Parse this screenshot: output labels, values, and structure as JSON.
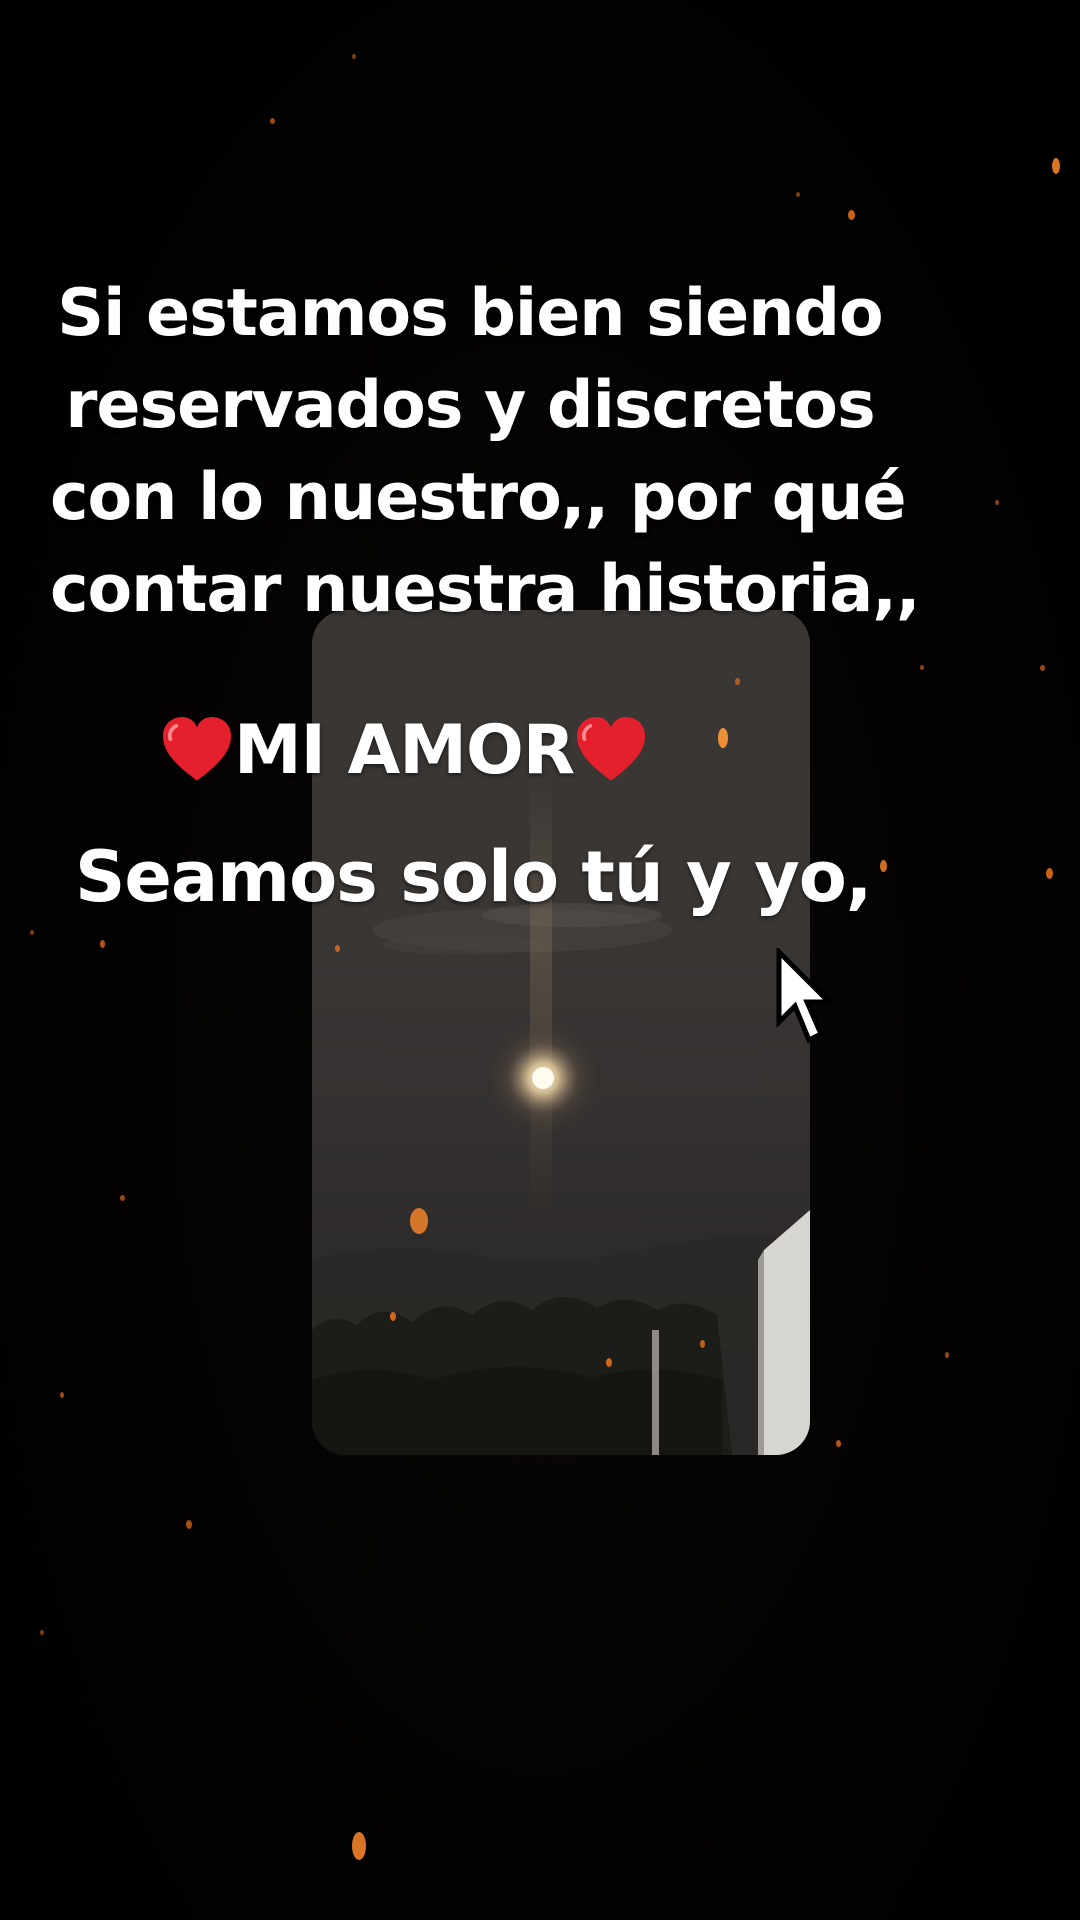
{
  "caption": {
    "lines": [
      "Si estamos bien siendo",
      "reservados y discretos",
      "con lo nuestro,, por qué",
      "contar nuestra historia,,"
    ],
    "love_text": "MI AMOR",
    "closing_line": "Seamos solo tú y yo,"
  },
  "icons": {
    "left_heart": "red-heart-emoji",
    "right_heart": "red-heart-emoji",
    "cursor": "mouse-pointer-icon"
  },
  "colors": {
    "background": "#000000",
    "text": "#ffffff",
    "heart": "#e3202c",
    "ember": "#ff8a2a"
  }
}
